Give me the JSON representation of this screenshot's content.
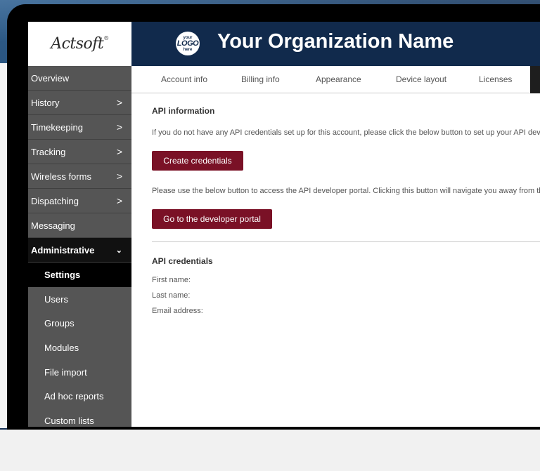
{
  "brand": {
    "logo_text": "Actsoft",
    "logo_mark": "®",
    "org_logo_small_top": "your",
    "org_logo_big": "LOGO",
    "org_logo_small_bottom": "here",
    "org_name": "Your Organization Name"
  },
  "colors": {
    "header_bg": "#112a4c",
    "sidebar_bg": "#555555",
    "button_bg": "#7a1126"
  },
  "sidebar": {
    "items": [
      {
        "label": "Overview",
        "chevron": ""
      },
      {
        "label": "History",
        "chevron": ">"
      },
      {
        "label": "Timekeeping",
        "chevron": ">"
      },
      {
        "label": "Tracking",
        "chevron": ">"
      },
      {
        "label": "Wireless forms",
        "chevron": ">"
      },
      {
        "label": "Dispatching",
        "chevron": ">"
      },
      {
        "label": "Messaging",
        "chevron": ""
      }
    ],
    "admin": {
      "label": "Administrative",
      "chevron": "⌄"
    },
    "sub_items": [
      {
        "label": "Settings"
      },
      {
        "label": "Users"
      },
      {
        "label": "Groups"
      },
      {
        "label": "Modules"
      },
      {
        "label": "File import"
      },
      {
        "label": "Ad hoc reports"
      },
      {
        "label": "Custom lists"
      }
    ]
  },
  "tabs": [
    {
      "label": "Account info"
    },
    {
      "label": "Billing info"
    },
    {
      "label": "Appearance"
    },
    {
      "label": "Device layout"
    },
    {
      "label": "Licenses"
    }
  ],
  "api_info": {
    "title": "API information",
    "desc1": "If you do not have any API credentials set up for this account, please click the below button to set up your API devel",
    "create_button": "Create credentials",
    "desc2": "Please use the below button to access the API developer portal. Clicking this button will navigate you away from the",
    "portal_button": "Go to the developer portal"
  },
  "api_credentials": {
    "title": "API credentials",
    "first_name_label": "First name:",
    "last_name_label": "Last name:",
    "email_label": "Email address:"
  }
}
